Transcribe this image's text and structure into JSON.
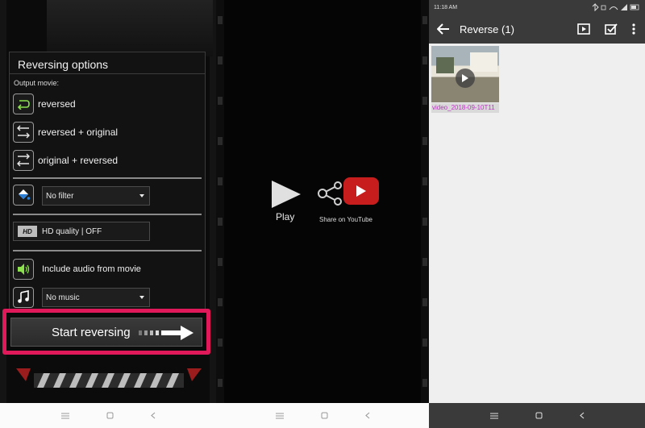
{
  "panel1": {
    "title": "Reversing options",
    "output_label": "Output movie:",
    "options": [
      {
        "label": "reversed",
        "icon": "reverse-arrow-icon"
      },
      {
        "label": "reversed + original",
        "icon": "reverse-original-icon"
      },
      {
        "label": "original + reversed",
        "icon": "original-reverse-icon"
      }
    ],
    "filter": {
      "selected": "No filter",
      "icon": "paint-bucket-icon"
    },
    "quality": {
      "label": "HD quality | OFF",
      "badge": "HD"
    },
    "audio": {
      "label": "Include audio from movie",
      "icon": "speaker-icon"
    },
    "music": {
      "selected": "No music",
      "icon": "music-note-icon"
    },
    "start_button": "Start reversing",
    "highlight_color": "#e0195a"
  },
  "panel2": {
    "play_label": "Play",
    "share_label": "Share on YouTube"
  },
  "panel3": {
    "status_time": "11:18 AM",
    "title": "Reverse (1)",
    "video_name": "video_2018-09-10T11",
    "accent_color": "#c02fc7"
  }
}
